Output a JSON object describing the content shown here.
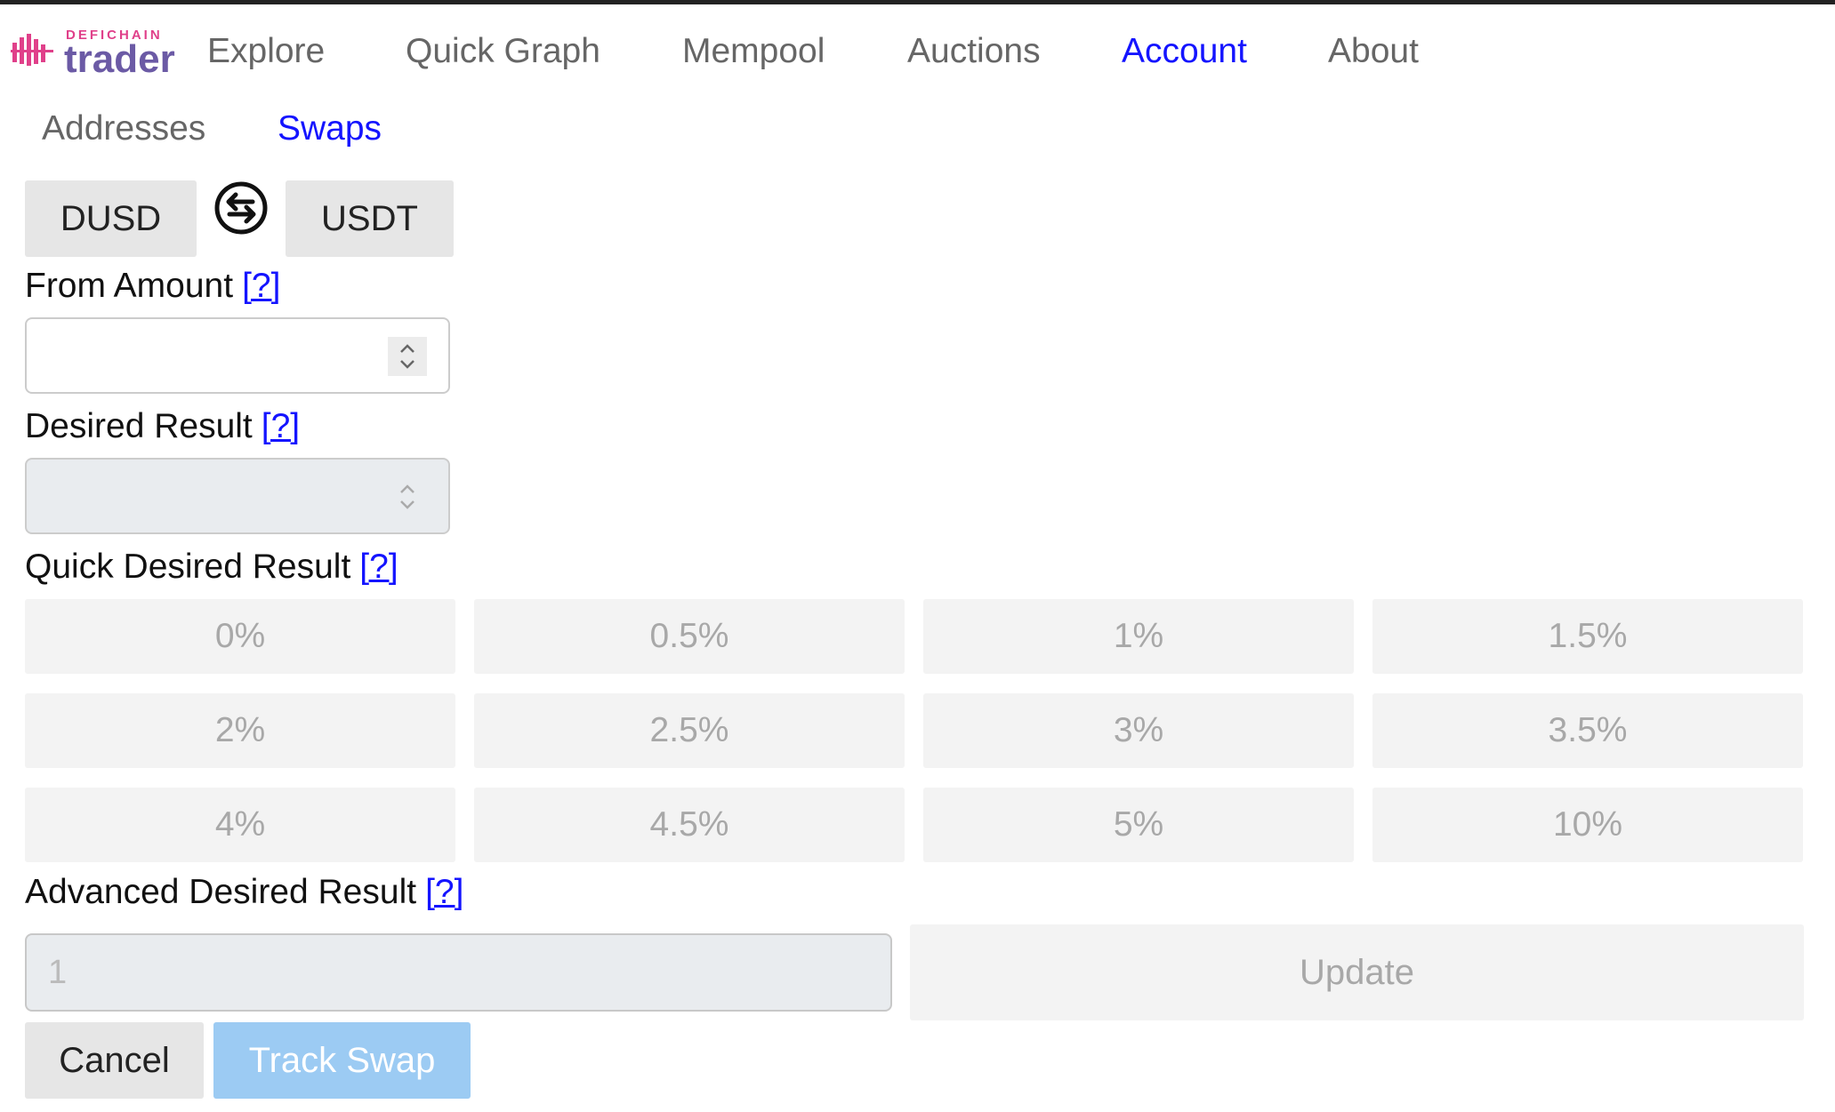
{
  "logo": {
    "small_text": "DEFICHAIN",
    "big_text": "trader"
  },
  "nav": {
    "items": [
      "Explore",
      "Quick Graph",
      "Mempool",
      "Auctions",
      "Account",
      "About"
    ],
    "active": "Account"
  },
  "subnav": {
    "items": [
      "Addresses",
      "Swaps"
    ],
    "active": "Swaps"
  },
  "swap": {
    "from_token": "DUSD",
    "to_token": "USDT"
  },
  "form": {
    "from_amount_label": "From Amount",
    "desired_result_label": "Desired Result",
    "quick_desired_result_label": "Quick Desired Result",
    "advanced_desired_result_label": "Advanced Desired Result",
    "help_text": "[?]",
    "from_amount_value": "",
    "desired_result_value": "",
    "advanced_placeholder": "1"
  },
  "quick_buttons": [
    "0%",
    "0.5%",
    "1%",
    "1.5%",
    "2%",
    "2.5%",
    "3%",
    "3.5%",
    "4%",
    "4.5%",
    "5%",
    "10%"
  ],
  "actions": {
    "update": "Update",
    "cancel": "Cancel",
    "track": "Track Swap"
  },
  "colors": {
    "link_active": "#1414ff",
    "track_button": "#9ccbf3",
    "logo_pink": "#e0408a",
    "logo_purple": "#6b5aa5"
  }
}
